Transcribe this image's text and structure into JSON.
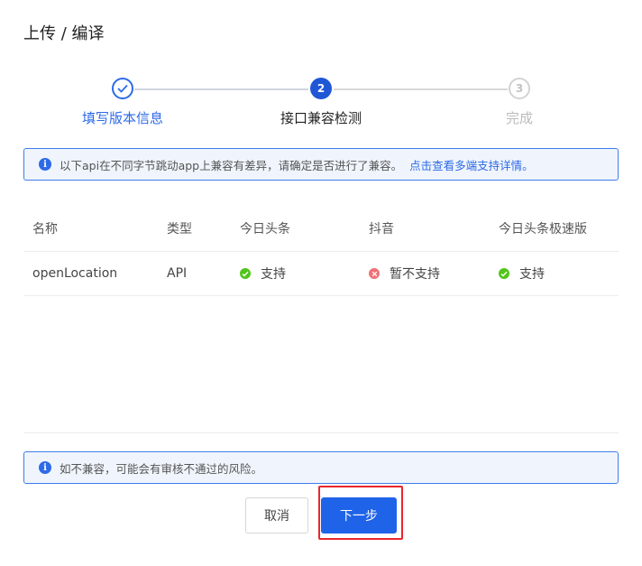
{
  "dialog": {
    "title": "上传 / 编译"
  },
  "steps": [
    {
      "number": "1",
      "label": "填写版本信息",
      "state": "done"
    },
    {
      "number": "2",
      "label": "接口兼容检测",
      "state": "active"
    },
    {
      "number": "3",
      "label": "完成",
      "state": "pending"
    }
  ],
  "alert_top": {
    "icon": "info-icon",
    "text": "以下api在不同字节跳动app上兼容有差异，请确定是否进行了兼容。",
    "link": "点击查看多端支持详情。"
  },
  "table": {
    "columns": [
      "名称",
      "类型",
      "今日头条",
      "抖音",
      "今日头条极速版"
    ],
    "rows": [
      {
        "name": "openLocation",
        "type": "API",
        "toutiao": {
          "text": "支持",
          "status": "supported"
        },
        "douyin": {
          "text": "暂不支持",
          "status": "unsupported"
        },
        "toutiao_lite": {
          "text": "支持",
          "status": "supported"
        }
      }
    ]
  },
  "alert_bottom": {
    "icon": "info-icon",
    "text": "如不兼容，可能会有审核不通过的风险。"
  },
  "buttons": {
    "cancel": "取消",
    "next": "下一步"
  },
  "colors": {
    "primary": "#1f63e9",
    "supported": "#52c41a",
    "unsupported": "#f07176",
    "highlight": "#e8272b"
  }
}
